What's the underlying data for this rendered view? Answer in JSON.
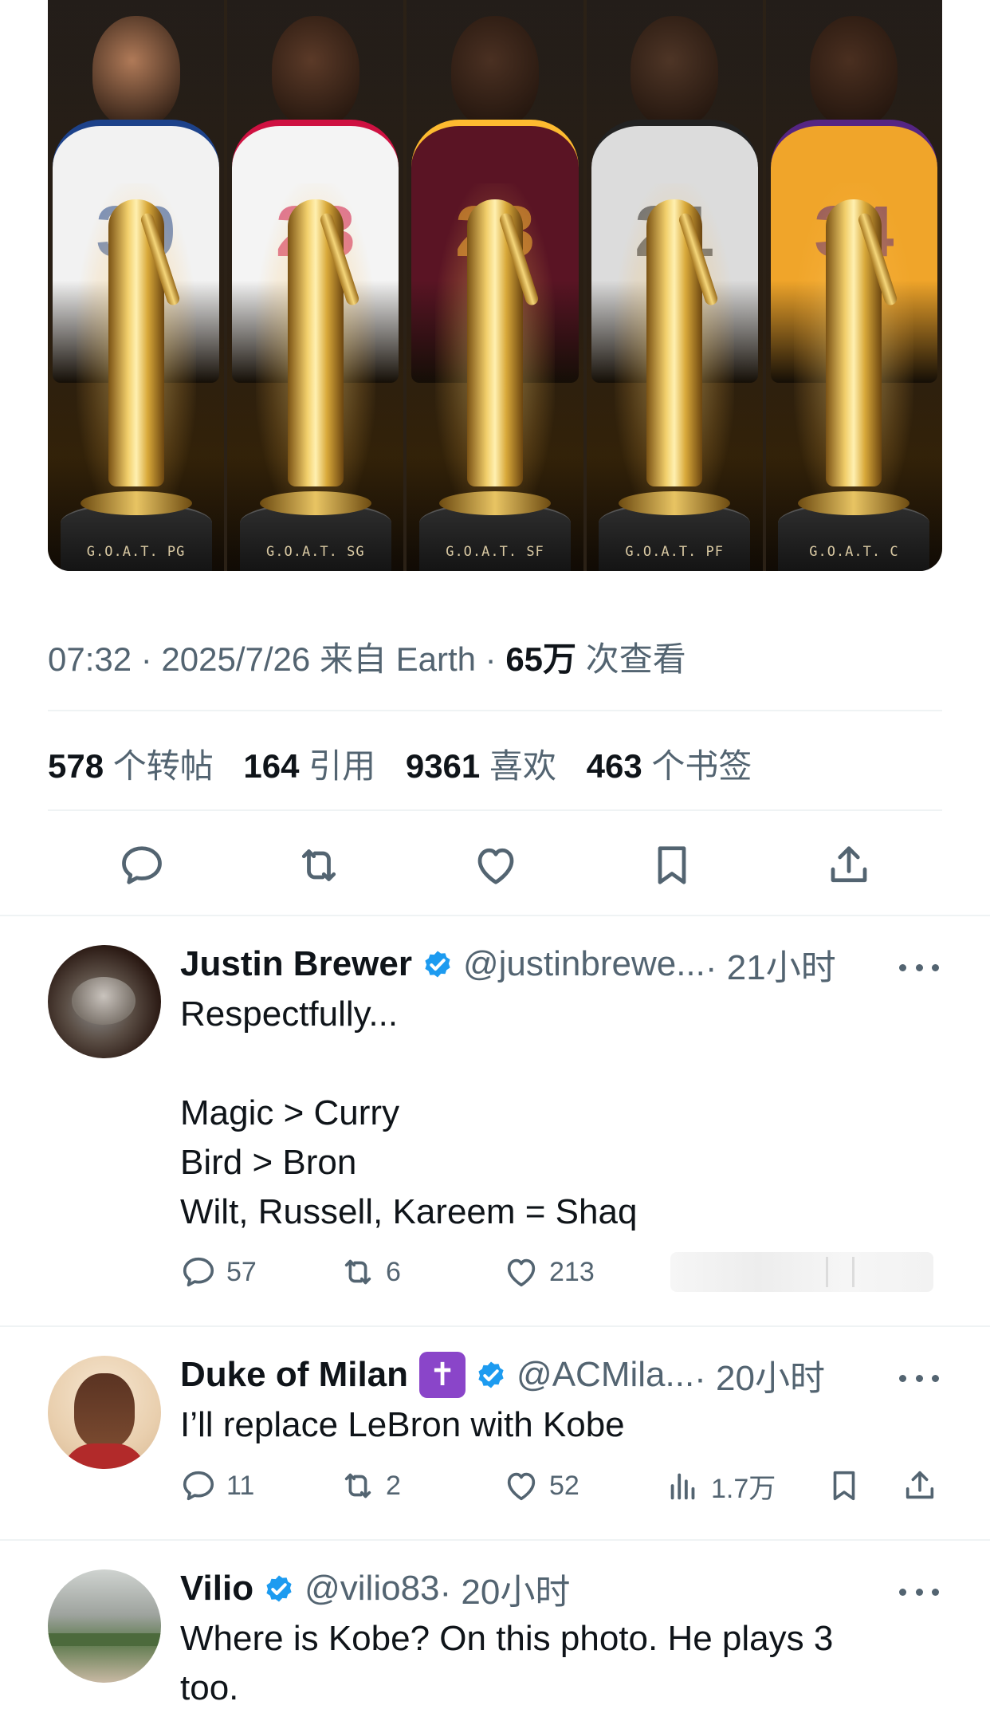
{
  "hero": {
    "panels": [
      {
        "label": "G.O.A.T. PG",
        "jersey": "#f2f2f2",
        "accent": "#1d428a",
        "number": "30",
        "skin": "#b07a58"
      },
      {
        "label": "G.O.A.T. SG",
        "jersey": "#f4f4f4",
        "accent": "#ce1141",
        "number": "23",
        "skin": "#5b3a28"
      },
      {
        "label": "G.O.A.T. SF",
        "jersey": "#5a1424",
        "accent": "#fdbb30",
        "number": "23",
        "skin": "#4a3022"
      },
      {
        "label": "G.O.A.T. PF",
        "jersey": "#dcdcdc",
        "accent": "#222222",
        "number": "21",
        "skin": "#4e3526"
      },
      {
        "label": "G.O.A.T. C",
        "jersey": "#f0a52a",
        "accent": "#552583",
        "number": "34",
        "skin": "#4a2f20"
      }
    ]
  },
  "tweet_meta": {
    "time_date_source": "07:32 · 2025/7/26 来自 Earth · ",
    "views_count": "65万",
    "views_label": " 次查看"
  },
  "stats": {
    "retweets_count": "578",
    "retweets_label": " 个转帖",
    "quotes_count": "164",
    "quotes_label": " 引用",
    "likes_count": "9361",
    "likes_label": " 喜欢",
    "bookmarks_count": "463",
    "bookmarks_label": " 个书签"
  },
  "actions": [
    "reply",
    "retweet",
    "like",
    "bookmark",
    "share"
  ],
  "colors": {
    "verified": "#1d9bf0",
    "secondary_text": "#536471",
    "primary_text": "#0f1419",
    "divider": "#eff3f4"
  },
  "replies": [
    {
      "name": "Justin Brewer",
      "handle": "@justinbrewe...",
      "time": " · 21小时",
      "text": "Respectfully...\n\nMagic > Curry\nBird > Bron\nWilt, Russell, Kareem = Shaq",
      "reply_count": "57",
      "retweet_count": "6",
      "like_count": "213"
    },
    {
      "name": "Duke of Milan",
      "badge": "✝",
      "handle": "@ACMila...",
      "time": " · 20小时",
      "text": "I’ll replace LeBron with Kobe",
      "reply_count": "11",
      "retweet_count": "2",
      "like_count": "52",
      "view_count": "1.7万"
    },
    {
      "name": "Vilio",
      "handle": "@vilio83",
      "time": " · 20小时",
      "text": "Where is Kobe? On this photo. He plays 3\ntoo."
    }
  ]
}
